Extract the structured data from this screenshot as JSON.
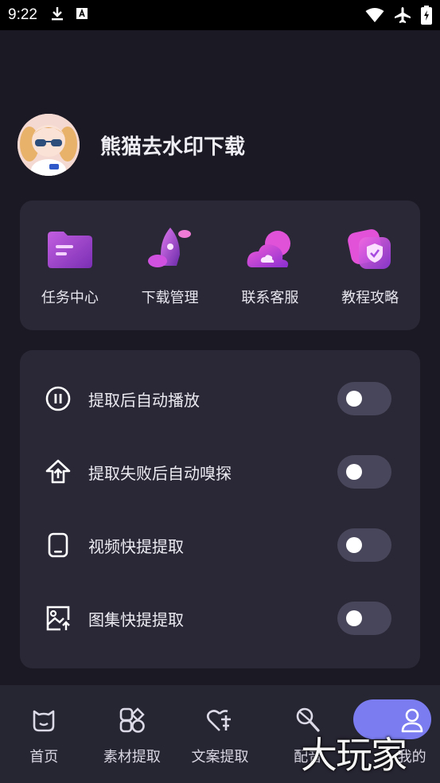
{
  "status_bar": {
    "time": "9:22",
    "icons_left": [
      "download-icon",
      "a-box-icon"
    ],
    "icons_right": [
      "wifi-icon",
      "airplane-icon",
      "battery-icon"
    ]
  },
  "profile": {
    "name": "熊猫去水印下载"
  },
  "quick_actions": [
    {
      "label": "任务中心",
      "icon": "folder-icon"
    },
    {
      "label": "下载管理",
      "icon": "rocket-icon"
    },
    {
      "label": "联系客服",
      "icon": "cloud-icon"
    },
    {
      "label": "教程攻略",
      "icon": "shield-icon"
    }
  ],
  "settings": [
    {
      "label": "提取后自动播放",
      "icon": "pause-circle-icon",
      "enabled": false
    },
    {
      "label": "提取失败后自动嗅探",
      "icon": "upload-house-icon",
      "enabled": false
    },
    {
      "label": "视频快提提取",
      "icon": "tablet-icon",
      "enabled": false
    },
    {
      "label": "图集快提提取",
      "icon": "image-upload-icon",
      "enabled": false
    }
  ],
  "bottom_nav": [
    {
      "label": "首页",
      "icon": "home-cat-icon"
    },
    {
      "label": "素材提取",
      "icon": "shapes-icon"
    },
    {
      "label": "文案提取",
      "icon": "heart-text-icon"
    },
    {
      "label": "配音",
      "icon": "magnifier-icon"
    },
    {
      "label": "我的",
      "icon": "user-icon",
      "active": true
    }
  ],
  "watermark": "大玩家",
  "colors": {
    "background": "#1b1a24",
    "card": "#2a2836",
    "accent": "#7b7cf0",
    "toggle_off": "#48465a"
  }
}
